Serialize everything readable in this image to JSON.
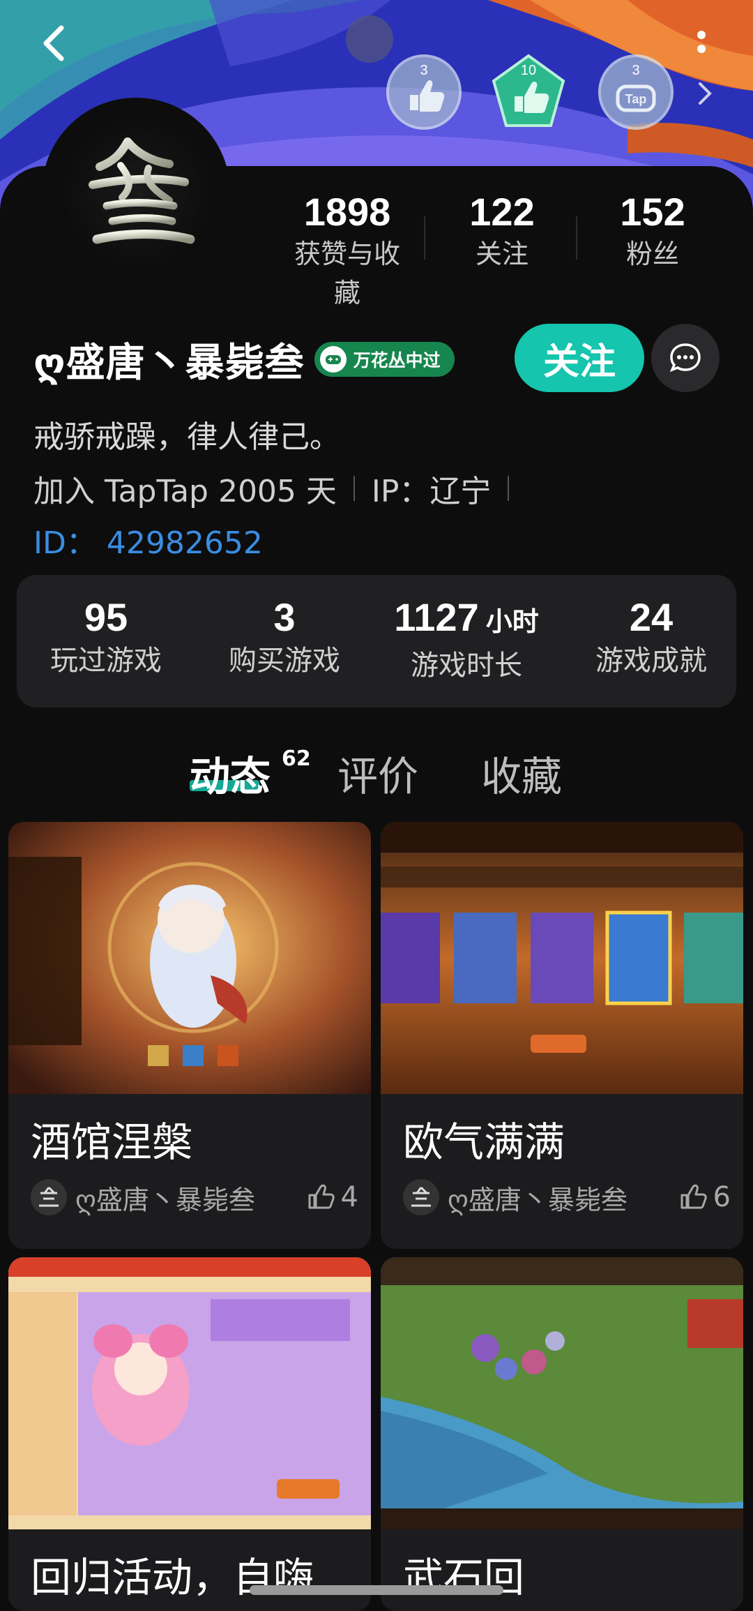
{
  "header": {
    "badges": [
      {
        "count": "3",
        "name": "thumbs-up-badge",
        "color": "#8aa6c8"
      },
      {
        "count": "10",
        "name": "thumbs-up-badge-green",
        "color": "#2cb88c"
      },
      {
        "count": "3",
        "name": "tap-badge",
        "color": "#8aa6c8"
      }
    ]
  },
  "profile": {
    "stats": [
      {
        "value": "1898",
        "label": "获赞与收藏"
      },
      {
        "value": "122",
        "label": "关注"
      },
      {
        "value": "152",
        "label": "粉丝"
      }
    ],
    "name": "ღ盛唐丶暴毙叁",
    "tag": "万花丛中过",
    "follow_label": "关注",
    "bio": "戒骄戒躁，律人律己。",
    "joined": "加入 TapTap 2005 天",
    "ip": "IP：辽宁",
    "id_label": "ID：",
    "id_value": "42982652"
  },
  "game_stats": [
    {
      "value": "95",
      "unit": "",
      "label": "玩过游戏"
    },
    {
      "value": "3",
      "unit": "",
      "label": "购买游戏"
    },
    {
      "value": "1127",
      "unit": "小时",
      "label": "游戏时长"
    },
    {
      "value": "24",
      "unit": "",
      "label": "游戏成就"
    }
  ],
  "tabs": {
    "items": [
      {
        "label": "动态"
      },
      {
        "label": "评价"
      },
      {
        "label": "收藏"
      }
    ],
    "active_count": "62"
  },
  "posts": [
    {
      "title": "酒馆涅槃",
      "author": "ღ盛唐丶暴毙叁",
      "likes": "4"
    },
    {
      "title": "欧气满满",
      "author": "ღ盛唐丶暴毙叁",
      "likes": "6"
    },
    {
      "title": "回归活动，自嗨",
      "author": "",
      "likes": ""
    },
    {
      "title": "武石回",
      "author": "",
      "likes": ""
    }
  ],
  "colors": {
    "accent": "#15c5ad",
    "link": "#3a8ee2",
    "tag": "#17864e",
    "background": "#0d0d0e"
  }
}
